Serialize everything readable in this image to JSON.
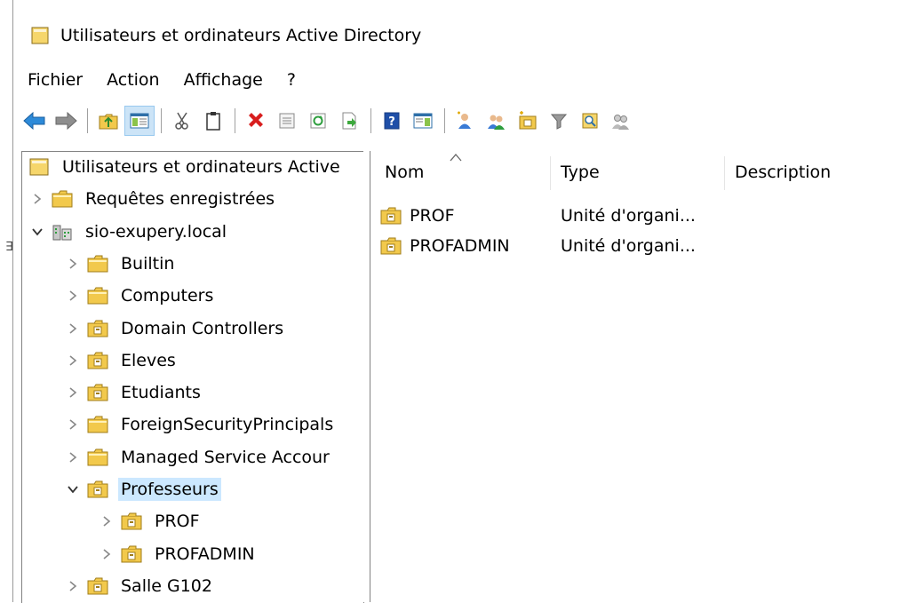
{
  "window": {
    "title": "Utilisateurs et ordinateurs Active Directory"
  },
  "menu": {
    "items": [
      "Fichier",
      "Action",
      "Affichage",
      "?"
    ]
  },
  "tree": {
    "items": [
      {
        "label": "Utilisateurs et ordinateurs Active",
        "icon": "ad-root-icon",
        "expander": "none",
        "indent": 0
      },
      {
        "label": "Requêtes enregistrées",
        "icon": "folder-icon",
        "expander": "collapsed",
        "indent": 0
      },
      {
        "label": "sio-exupery.local",
        "icon": "domain-icon",
        "expander": "expanded",
        "indent": 0
      },
      {
        "label": "Builtin",
        "icon": "folder-icon",
        "expander": "collapsed",
        "indent": 1
      },
      {
        "label": "Computers",
        "icon": "folder-icon",
        "expander": "collapsed",
        "indent": 1
      },
      {
        "label": "Domain Controllers",
        "icon": "ou-icon",
        "expander": "collapsed",
        "indent": 1
      },
      {
        "label": "Eleves",
        "icon": "ou-icon",
        "expander": "collapsed",
        "indent": 1
      },
      {
        "label": "Etudiants",
        "icon": "ou-icon",
        "expander": "collapsed",
        "indent": 1
      },
      {
        "label": "ForeignSecurityPrincipals",
        "icon": "folder-icon",
        "expander": "collapsed",
        "indent": 1
      },
      {
        "label": "Managed Service Accour",
        "icon": "folder-icon",
        "expander": "collapsed",
        "indent": 1
      },
      {
        "label": "Professeurs",
        "icon": "ou-icon",
        "expander": "expanded",
        "indent": 1,
        "selected": true
      },
      {
        "label": "PROF",
        "icon": "ou-icon",
        "expander": "collapsed",
        "indent": 2
      },
      {
        "label": "PROFADMIN",
        "icon": "ou-icon",
        "expander": "collapsed",
        "indent": 2
      },
      {
        "label": "Salle G102",
        "icon": "ou-icon",
        "expander": "collapsed",
        "indent": 1
      }
    ]
  },
  "list": {
    "columns": [
      "Nom",
      "Type",
      "Description"
    ],
    "rows": [
      {
        "name": "PROF",
        "type": "Unité d'organi...",
        "description": ""
      },
      {
        "name": "PROFADMIN",
        "type": "Unité d'organi...",
        "description": ""
      }
    ]
  },
  "colors": {
    "selection": "#cce8ff",
    "folder": "#f2c94c",
    "border": "#828282"
  }
}
